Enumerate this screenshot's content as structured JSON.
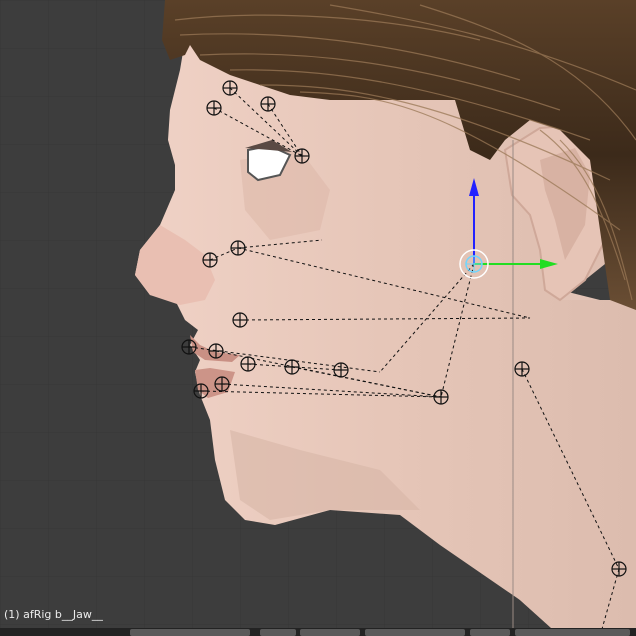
{
  "viewport": {
    "status_text": "(1) afRig b__Jaw__",
    "background_color": "#3d3d3d",
    "grid_color": "#353535"
  },
  "colors": {
    "skin": "#e8c8bb",
    "skin_shadow": "#c9a394",
    "hair": "#4a3422",
    "hair_light": "#8a6a4a",
    "lip": "#c48a7f",
    "bone_line": "#111111",
    "gizmo_z": "#2222ff",
    "gizmo_y": "#22dd22",
    "gizmo_center": "#6fd6ff"
  },
  "icons": [
    "transform-gizmo-icon",
    "bone-joint-icon"
  ],
  "armature": {
    "name": "afRig",
    "active_bone": "b__Jaw__"
  }
}
